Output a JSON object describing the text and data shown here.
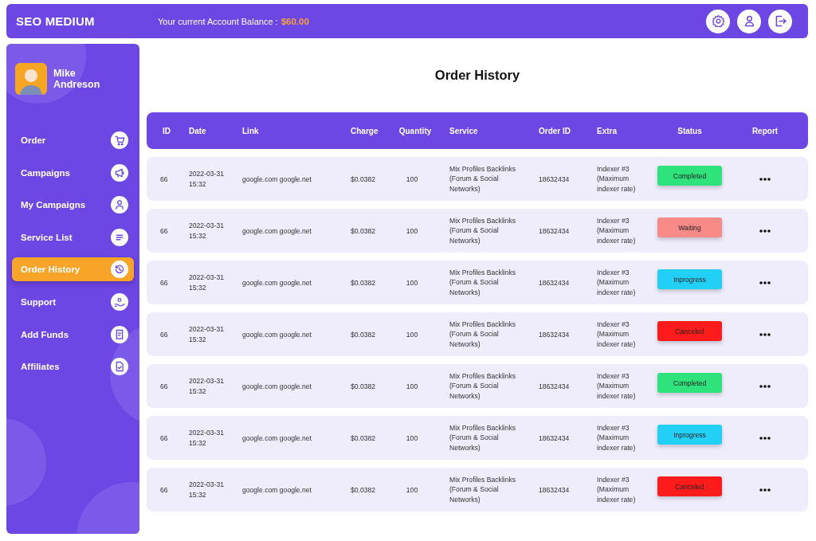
{
  "topbar": {
    "title": "SEO MEDIUM",
    "balance_label": "Your current Account Balance :",
    "balance_value": "$60.00"
  },
  "profile": {
    "name": "Mike Andreson"
  },
  "sidebar": {
    "items": [
      {
        "label": "Order",
        "selected": false
      },
      {
        "label": "Campaigns",
        "selected": false
      },
      {
        "label": "My Campaigns",
        "selected": false
      },
      {
        "label": "Service List",
        "selected": false
      },
      {
        "label": "Order History",
        "selected": true
      },
      {
        "label": "Support",
        "selected": false
      },
      {
        "label": "Add Funds",
        "selected": false
      },
      {
        "label": "Affiliates",
        "selected": false
      }
    ]
  },
  "page": {
    "title": "Order History"
  },
  "table": {
    "columns": [
      "ID",
      "Date",
      "Link",
      "Charge",
      "Quantity",
      "Service",
      "Order ID",
      "Extra",
      "Status",
      "Report"
    ],
    "rows": [
      {
        "id": "66",
        "date": "2022-03-31 15:32",
        "link": "google.com google.net",
        "charge": "$0.0382",
        "quantity": "100",
        "service": "Mix Profiles Backlinks (Forum & Social Networks)",
        "order_id": "18632434",
        "extra": "Indexer #3 (Maximum indexer rate)",
        "status": {
          "label": "Completed",
          "color": "#2ee27c"
        }
      },
      {
        "id": "66",
        "date": "2022-03-31 15:32",
        "link": "google.com google.net",
        "charge": "$0.0382",
        "quantity": "100",
        "service": "Mix Profiles Backlinks (Forum & Social Networks)",
        "order_id": "18632434",
        "extra": "Indexer #3 (Maximum indexer rate)",
        "status": {
          "label": "Waiting",
          "color": "#f88a88"
        }
      },
      {
        "id": "66",
        "date": "2022-03-31 15:32",
        "link": "google.com google.net",
        "charge": "$0.0382",
        "quantity": "100",
        "service": "Mix Profiles Backlinks (Forum & Social Networks)",
        "order_id": "18632434",
        "extra": "Indexer #3 (Maximum indexer rate)",
        "status": {
          "label": "Inprogress",
          "color": "#22d0f6"
        }
      },
      {
        "id": "66",
        "date": "2022-03-31 15:32",
        "link": "google.com google.net",
        "charge": "$0.0382",
        "quantity": "100",
        "service": "Mix Profiles Backlinks (Forum & Social Networks)",
        "order_id": "18632434",
        "extra": "Indexer #3 (Maximum indexer rate)",
        "status": {
          "label": "Canceled",
          "color": "#fd1b1b"
        }
      },
      {
        "id": "66",
        "date": "2022-03-31 15:32",
        "link": "google.com google.net",
        "charge": "$0.0382",
        "quantity": "100",
        "service": "Mix Profiles Backlinks (Forum & Social Networks)",
        "order_id": "18632434",
        "extra": "Indexer #3 (Maximum indexer rate)",
        "status": {
          "label": "Completed",
          "color": "#2ee27c"
        }
      },
      {
        "id": "66",
        "date": "2022-03-31 15:32",
        "link": "google.com google.net",
        "charge": "$0.0382",
        "quantity": "100",
        "service": "Mix Profiles Backlinks (Forum & Social Networks)",
        "order_id": "18632434",
        "extra": "Indexer #3 (Maximum indexer rate)",
        "status": {
          "label": "Inprogress",
          "color": "#22d0f6"
        }
      },
      {
        "id": "66",
        "date": "2022-03-31 15:32",
        "link": "google.com google.net",
        "charge": "$0.0382",
        "quantity": "100",
        "service": "Mix Profiles Backlinks (Forum & Social Networks)",
        "order_id": "18632434",
        "extra": "Indexer #3 (Maximum indexer rate)",
        "status": {
          "label": "Canceled",
          "color": "#fd1b1b"
        }
      }
    ]
  }
}
